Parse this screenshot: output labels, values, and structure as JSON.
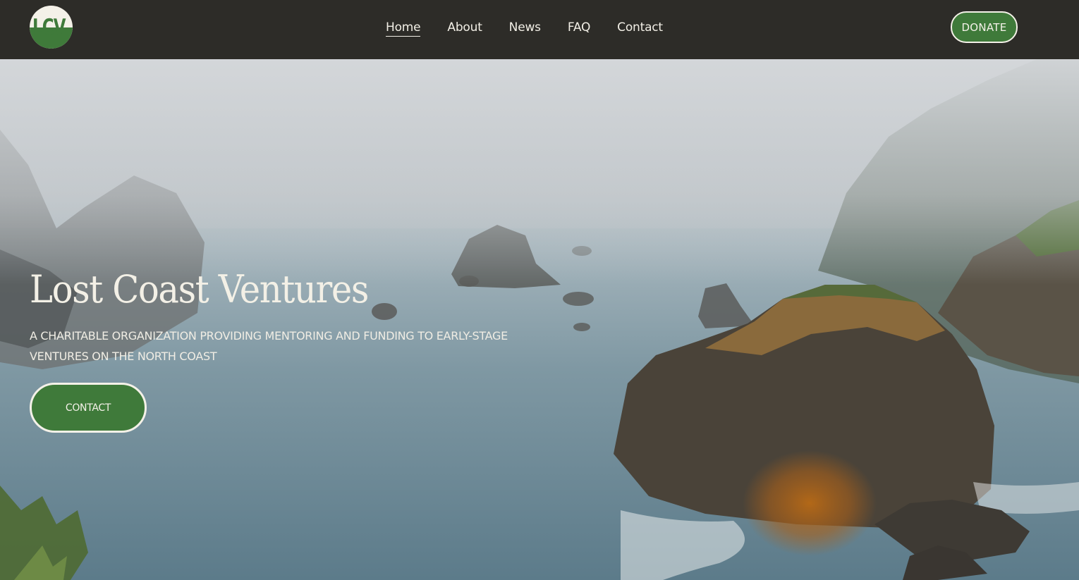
{
  "header": {
    "logo_text": "LCV",
    "nav": [
      {
        "label": "Home",
        "active": true
      },
      {
        "label": "About",
        "active": false
      },
      {
        "label": "News",
        "active": false
      },
      {
        "label": "FAQ",
        "active": false
      },
      {
        "label": "Contact",
        "active": false
      }
    ],
    "donate_label": "DONATE"
  },
  "hero": {
    "title": "Lost Coast Ventures",
    "subtitle": "A CHARITABLE ORGANIZATION PROVIDING MENTORING AND FUNDING TO EARLY-STAGE VENTURES ON THE NORTH COAST",
    "cta_label": "CONTACT"
  },
  "colors": {
    "header_bg": "#2d2c28",
    "accent_green": "#3f7a3a",
    "cream": "#f4f1e8"
  }
}
